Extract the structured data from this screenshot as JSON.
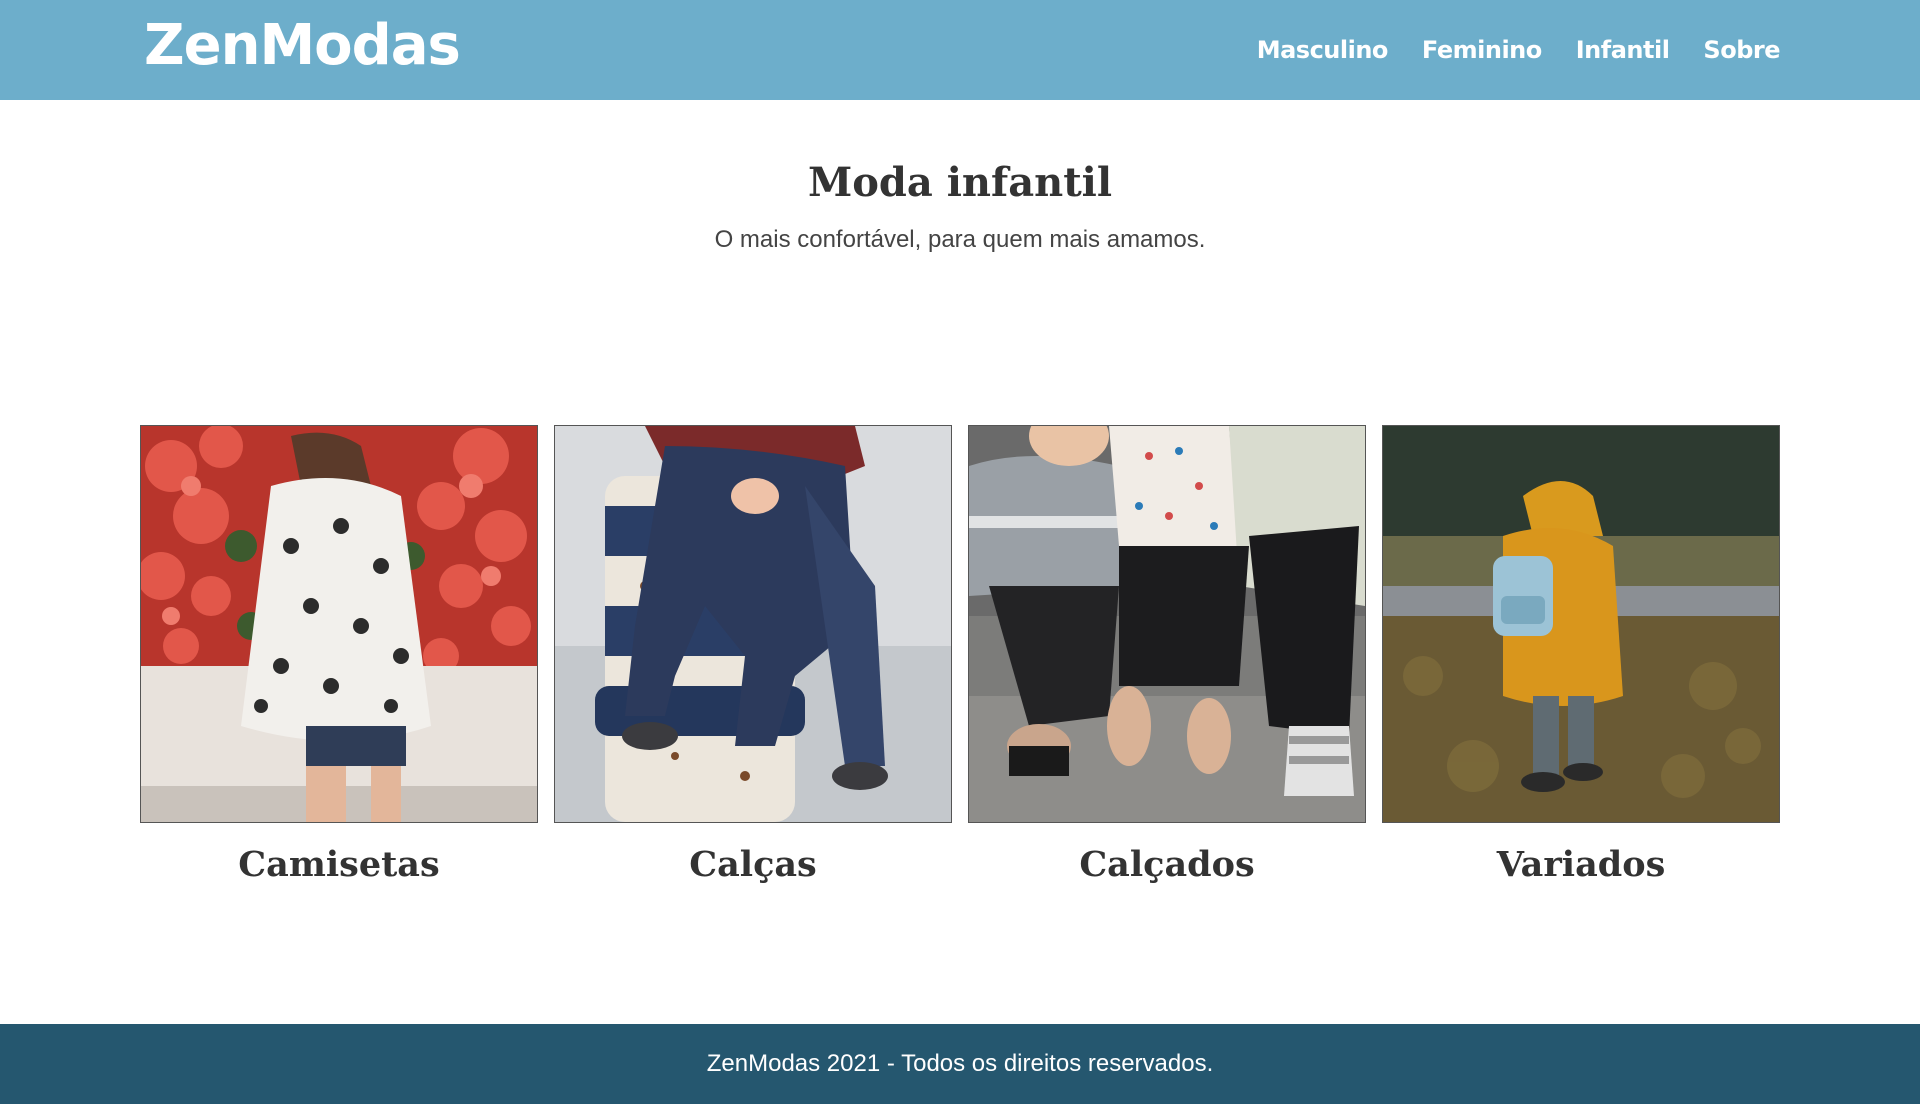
{
  "header": {
    "logo": "ZenModas",
    "nav": [
      {
        "label": "Masculino"
      },
      {
        "label": "Feminino"
      },
      {
        "label": "Infantil"
      },
      {
        "label": "Sobre"
      }
    ]
  },
  "intro": {
    "title": "Moda infantil",
    "subtitle": "O mais confortável, para quem mais amamos."
  },
  "categories": [
    {
      "label": "Camisetas",
      "image": "child-polka-dot-shirt-flowers-photo"
    },
    {
      "label": "Calças",
      "image": "child-jeans-sitting-on-bollard-photo"
    },
    {
      "label": "Calçados",
      "image": "children-feet-shoes-photo"
    },
    {
      "label": "Variados",
      "image": "child-yellow-raincoat-backpack-photo"
    }
  ],
  "footer": {
    "text": "ZenModas 2021 - Todos os direitos reservados."
  },
  "colors": {
    "header_bg": "#6daecb",
    "footer_bg": "#25576f",
    "heading_text": "#333333",
    "nav_text": "#ffffff"
  }
}
